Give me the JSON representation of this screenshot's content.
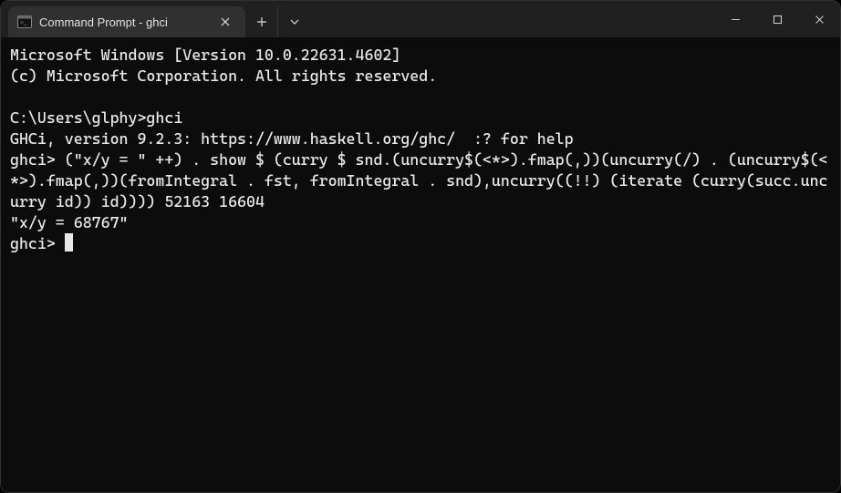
{
  "titlebar": {
    "tab_title": "Command Prompt - ghci"
  },
  "terminal": {
    "line1": "Microsoft Windows [Version 10.0.22631.4602]",
    "line2": "(c) Microsoft Corporation. All rights reserved.",
    "blank1": "",
    "line3": "C:\\Users\\glphy>ghci",
    "line4": "GHCi, version 9.2.3: https://www.haskell.org/ghc/  :? for help",
    "line5": "ghci> (\"x/y = \" ++) . show $ (curry $ snd.(uncurry$(<*>).fmap(,))(uncurry(/) . (uncurry$(<*>).fmap(,))(fromIntegral . fst, fromIntegral . snd),uncurry((!!) (iterate (curry(succ.uncurry id)) id)))) 52163 16604",
    "line6": "\"x/y = 68767\"",
    "line7": "ghci> "
  }
}
